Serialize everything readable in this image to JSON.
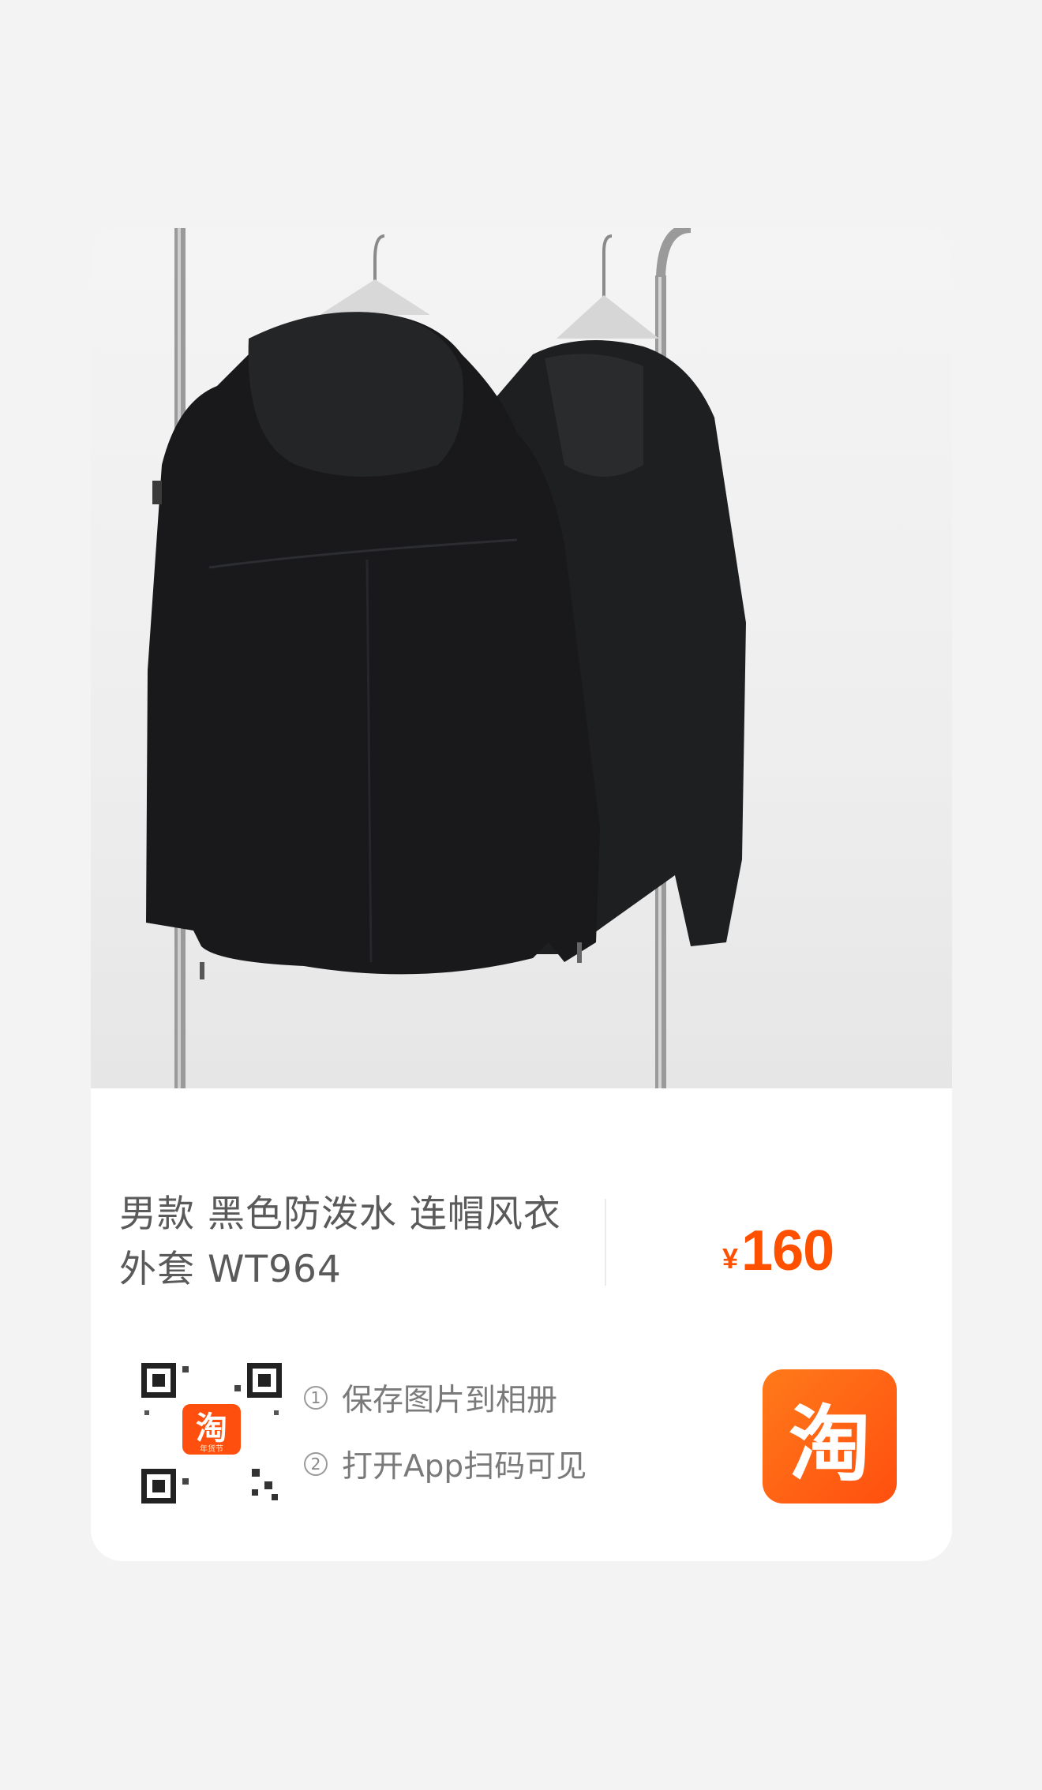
{
  "product": {
    "title_line1": "男款 黑色防泼水 连帽风衣",
    "title_line2": "外套 WT964",
    "price_symbol": "¥",
    "price_value": "160",
    "image_icon": "jacket-photo"
  },
  "share": {
    "qr_icon": "qr-code-icon",
    "qr_center_glyph": "淘",
    "qr_center_caption": "年货节",
    "steps": [
      {
        "number": "①",
        "label": "保存图片到相册"
      },
      {
        "number": "②",
        "label": "打开App扫码可见"
      }
    ],
    "app_logo_glyph": "淘"
  },
  "colors": {
    "price": "#ff5000",
    "logo_bg": "#ff5a12",
    "page_bg": "#f3f3f3"
  }
}
